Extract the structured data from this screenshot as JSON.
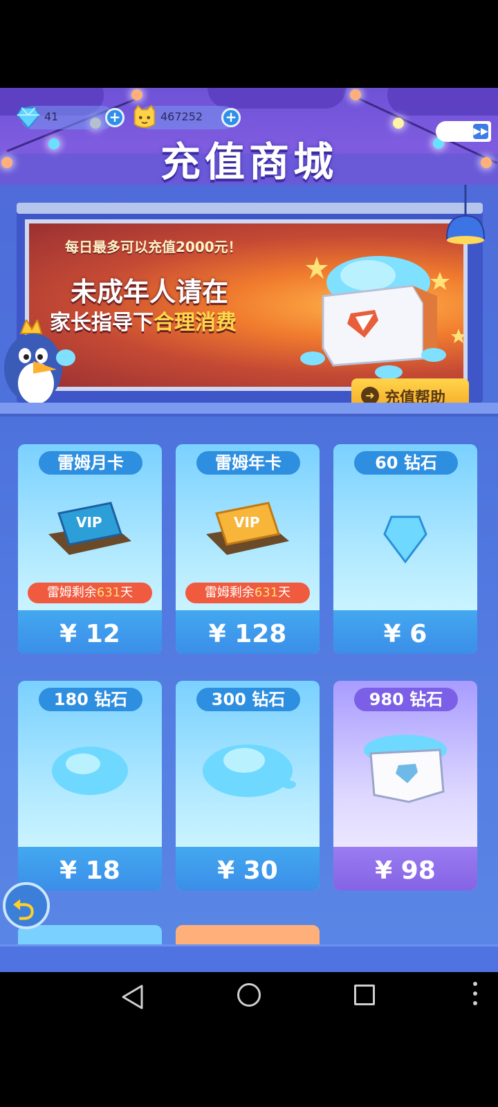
{
  "header": {
    "title": "充值商城",
    "diamonds": "41",
    "coins": "467252",
    "add_label": "+"
  },
  "banner": {
    "line1": "每日最多可以充值2000元！",
    "line2": "未成年人请在",
    "line3a": "家长指导下",
    "line3b": "合理消费",
    "help_label": "充值帮助"
  },
  "products": [
    {
      "name": "雷姆月卡",
      "price": "¥ 12",
      "remain_pre": "雷姆剩余",
      "remain_num": "631",
      "remain_post": "天"
    },
    {
      "name": "雷姆年卡",
      "price": "¥ 128",
      "remain_pre": "雷姆剩余",
      "remain_num": "631",
      "remain_post": "天"
    },
    {
      "name": "60 钻石",
      "price": "¥ 6"
    },
    {
      "name": "180 钻石",
      "price": "¥ 18"
    },
    {
      "name": "300 钻石",
      "price": "¥ 30"
    },
    {
      "name": "980 钻石",
      "price": "¥ 98"
    }
  ],
  "colors": {
    "accent": "#2e8fe0",
    "purple_accent": "#7b5fe6",
    "banner_red": "#c54a34",
    "highlight_yellow": "#ffd84a"
  },
  "icons": {
    "back": "back-arrow-icon",
    "diamond": "diamond-icon",
    "coin": "cat-coin-icon",
    "fast_forward": "fast-forward-icon"
  }
}
